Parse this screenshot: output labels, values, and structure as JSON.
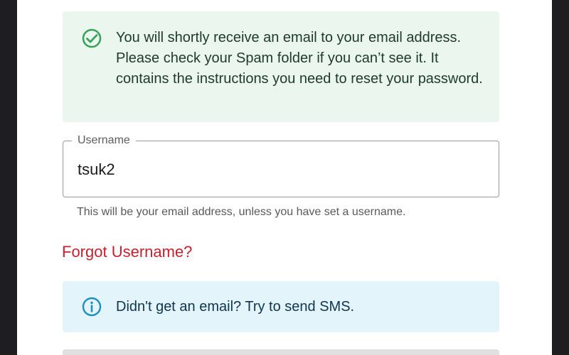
{
  "success_alert": {
    "message": "You will shortly receive an email to your email address. Please check your Spam folder if you can’t see it. It contains the instructions you need to reset your password.",
    "color": "#3aa35b",
    "icon": "check-circle-icon"
  },
  "username_field": {
    "label": "Username",
    "value": "tsuk2",
    "helper": "This will be your email address, unless you have set a username."
  },
  "forgot_link": {
    "label": "Forgot Username?",
    "color": "#c8202f"
  },
  "info_alert": {
    "message": "Didn't get an email? Try to send SMS.",
    "color": "#1c8fc0",
    "icon": "info-circle-icon"
  }
}
